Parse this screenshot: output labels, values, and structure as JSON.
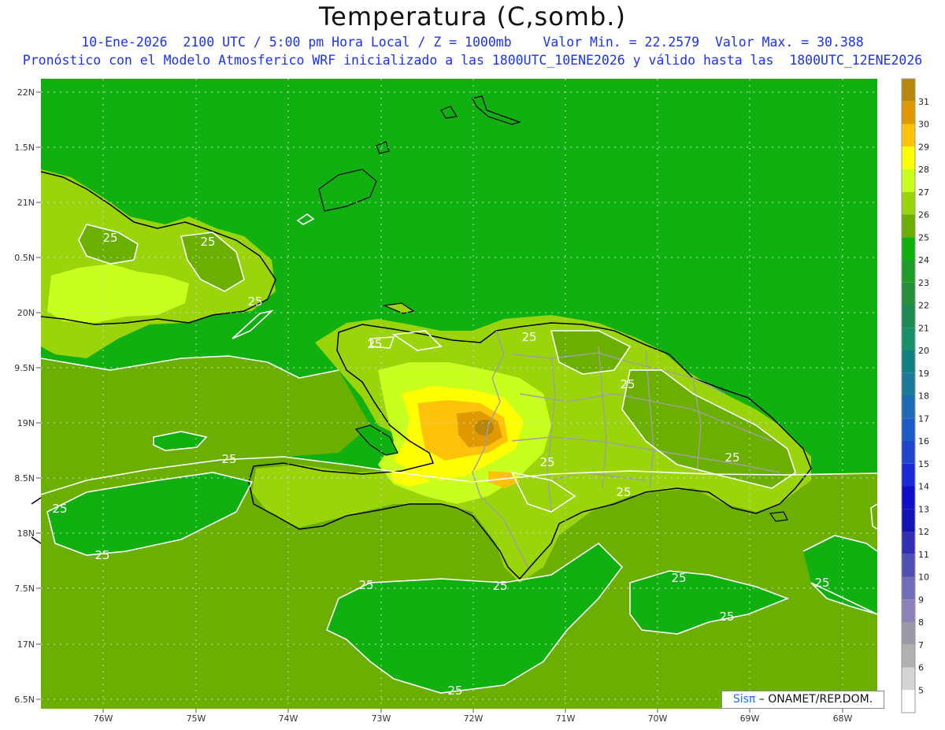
{
  "header": {
    "title": "Temperatura (C,somb.)",
    "line1": "10-Ene-2026  2100 UTC / 5:00 pm Hora Local / Z = 1000mb    Valor Min. = 22.2579  Valor Max. = 30.388",
    "line2": "Pronóstico con el Modelo Atmosferico WRF inicializado a las 1800UTC_10ENE2026 y válido hasta las  1800UTC_12ENE2026"
  },
  "axes": {
    "lat_ticks": [
      "22N",
      "1.5N",
      "21N",
      "0.5N",
      "20N",
      "9.5N",
      "19N",
      "8.5N",
      "18N",
      "7.5N",
      "17N",
      "6.5N"
    ],
    "lon_ticks": [
      "76W",
      "75W",
      "74W",
      "73W",
      "72W",
      "71W",
      "70W",
      "69W",
      "68W"
    ]
  },
  "contour_labels": [
    "25",
    "25",
    "25",
    "25",
    "25",
    "25",
    "25",
    "25",
    "25",
    "25",
    "25",
    "25",
    "25",
    "25",
    "25",
    "25",
    "25",
    "25"
  ],
  "colorbar": {
    "labels": [
      "31",
      "30",
      "29",
      "28",
      "27",
      "26",
      "25",
      "24",
      "23",
      "22",
      "21",
      "20",
      "19",
      "18",
      "17",
      "16",
      "15",
      "14",
      "13",
      "12",
      "11",
      "10",
      "9",
      "8",
      "7",
      "6",
      "5"
    ],
    "colors": [
      "#b8860b",
      "#e09a00",
      "#ffc20a",
      "#ffff00",
      "#c8ff1e",
      "#9ad40a",
      "#6bb000",
      "#10b010",
      "#1e9e28",
      "#24903a",
      "#1e8a50",
      "#18906c",
      "#108080",
      "#1a7a9a",
      "#1e6ab4",
      "#1e5ac8",
      "#1e46cc",
      "#1a2ad4",
      "#1010c8",
      "#1414b4",
      "#3030b4",
      "#5050b4",
      "#6e6eb8",
      "#8e80b8",
      "#9a9aa6",
      "#b0b0b0",
      "#d4d4d4",
      "#ffffff"
    ]
  },
  "field_colors": {
    "ocean": "#10b010",
    "warm_sea": "#6bb000",
    "land25": "#6bb000",
    "land26": "#9ad40a",
    "land27": "#c8ff1e",
    "land28": "#ffff00",
    "land29": "#ffc20a",
    "land30": "#e09a00",
    "land31": "#b8860b"
  },
  "badge": {
    "sis": "Sisπ",
    "rest": " – ONAMET/REP.DOM."
  }
}
